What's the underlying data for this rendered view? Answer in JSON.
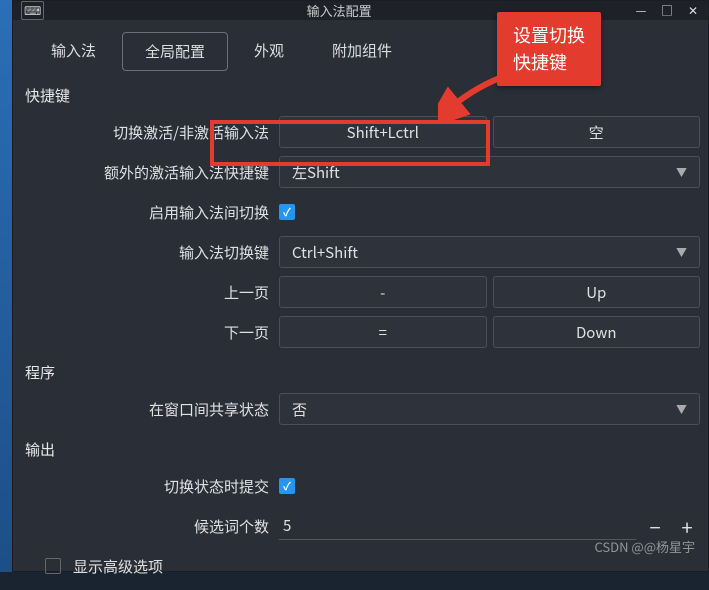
{
  "window": {
    "title": "输入法配置"
  },
  "tabs": {
    "input_method": "输入法",
    "global_config": "全局配置",
    "appearance": "外观",
    "addons": "附加组件"
  },
  "sections": {
    "hotkeys": "快捷键",
    "program": "程序",
    "output": "输出"
  },
  "rows": {
    "toggle_activate": {
      "label": "切换激活/非激活输入法",
      "val1": "Shift+Lctrl",
      "val2": "空"
    },
    "extra_hotkey": {
      "label": "额外的激活输入法快捷键",
      "value": "左Shift"
    },
    "enable_switch": {
      "label": "启用输入法间切换"
    },
    "switch_key": {
      "label": "输入法切换键",
      "value": "Ctrl+Shift"
    },
    "prev_page": {
      "label": "上一页",
      "val1": "-",
      "val2": "Up"
    },
    "next_page": {
      "label": "下一页",
      "val1": "=",
      "val2": "Down"
    },
    "share_state": {
      "label": "在窗口间共享状态",
      "value": "否"
    },
    "commit_on_switch": {
      "label": "切换状态时提交"
    },
    "candidate_count": {
      "label": "候选词个数",
      "value": "5"
    },
    "show_advanced": {
      "label": "显示高级选项"
    }
  },
  "annotation": {
    "callout_line1": "设置切换",
    "callout_line2": "快捷键"
  },
  "watermark": "CSDN @@杨星宇"
}
